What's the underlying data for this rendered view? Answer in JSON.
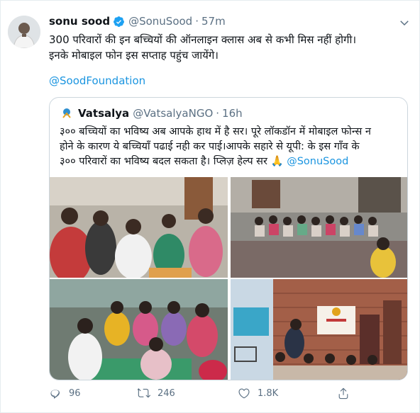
{
  "tweet": {
    "author_name": "sonu sood",
    "author_handle": "@SonuSood",
    "separator": "·",
    "time": "57m",
    "text_line1": "300 परिवारों की इन बच्चियों की ऑनलाइन क्लास अब से कभी मिस नहीं होगी।",
    "text_line2": "इनके मोबाइल फोन इस सप्ताह पहुंच जायेंगे।",
    "mention": "@SoodFoundation"
  },
  "quoted": {
    "author_name": "Vatsalya",
    "author_handle": "@VatsalyaNGO",
    "separator": "·",
    "time": "16h",
    "line1": "३०० बच्चियों का भविष्य अब आपके हाथ में है सर। पूरे लॉकडॉन में मोबाइल फोन्स न",
    "line2": "होने के कारण ये बच्चियाँ पढाई नही कर पाई।आपके सहारे से यूपी: के इस गाँव के",
    "line3": "३०० परिवारों का भविष्य बदल सकता है। प्लिज़ हेल्प सर 🙏",
    "line3_mention": "@SonuSood"
  },
  "actions": {
    "replies": "96",
    "retweets": "246",
    "likes": "1.8K"
  },
  "colors": {
    "link": "#1b95e0",
    "verified": "#1da1f2",
    "muted": "#5b7083",
    "border": "#ccd6dd"
  },
  "icons": [
    "verified-badge-icon",
    "chevron-down-icon",
    "reply-icon",
    "retweet-icon",
    "like-icon",
    "share-icon"
  ]
}
